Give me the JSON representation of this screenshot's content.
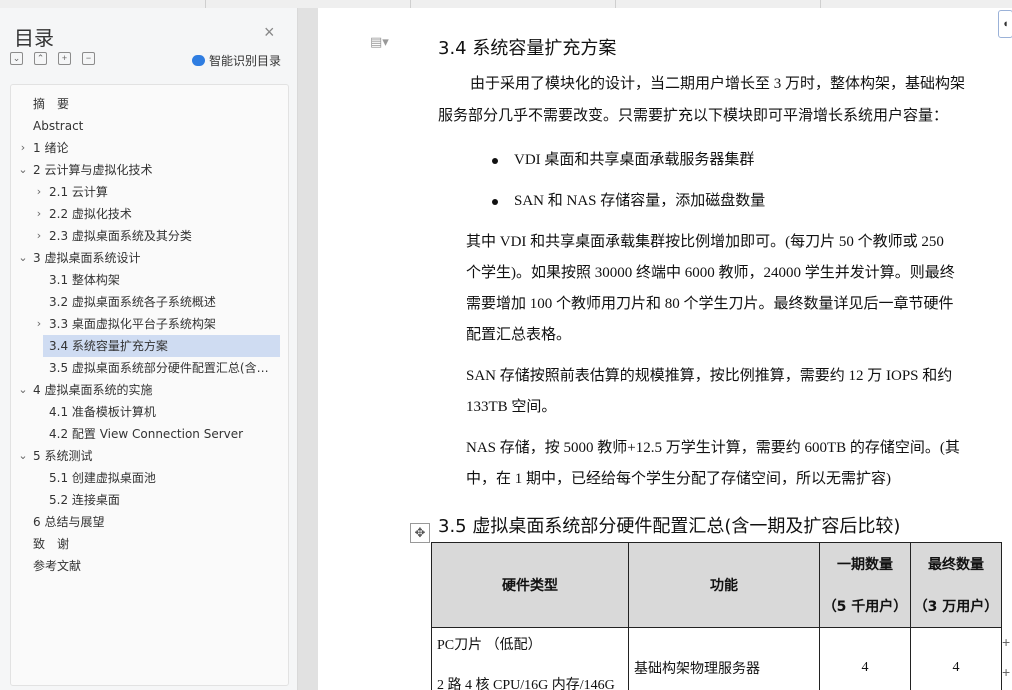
{
  "sidebar": {
    "title": "目录",
    "close_icon": "×",
    "smart_label": "智能识别目录",
    "items": [
      {
        "label": "摘　要",
        "level": 0,
        "expander": "",
        "selected": false
      },
      {
        "label": "Abstract",
        "level": 0,
        "expander": "",
        "selected": false
      },
      {
        "label": "1 绪论",
        "level": 0,
        "expander": "collapsed",
        "selected": false
      },
      {
        "label": "2 云计算与虚拟化技术",
        "level": 0,
        "expander": "expanded",
        "selected": false
      },
      {
        "label": "2.1 云计算",
        "level": 1,
        "expander": "collapsed",
        "selected": false
      },
      {
        "label": "2.2  虚拟化技术",
        "level": 1,
        "expander": "collapsed",
        "selected": false
      },
      {
        "label": "2.3  虚拟桌面系统及其分类",
        "level": 1,
        "expander": "collapsed",
        "selected": false
      },
      {
        "label": "3 虚拟桌面系统设计",
        "level": 0,
        "expander": "expanded",
        "selected": false
      },
      {
        "label": "3.1 整体构架",
        "level": 1,
        "expander": "",
        "selected": false
      },
      {
        "label": "3.2 虚拟桌面系统各子系统概述",
        "level": 1,
        "expander": "",
        "selected": false
      },
      {
        "label": "3.3 桌面虚拟化平台子系统构架",
        "level": 1,
        "expander": "collapsed",
        "selected": false
      },
      {
        "label": "3.4 系统容量扩充方案",
        "level": 1,
        "expander": "",
        "selected": true
      },
      {
        "label": "3.5 虚拟桌面系统部分硬件配置汇总(含…",
        "level": 1,
        "expander": "",
        "selected": false
      },
      {
        "label": "4 虚拟桌面系统的实施",
        "level": 0,
        "expander": "expanded",
        "selected": false
      },
      {
        "label": "4.1 准备模板计算机",
        "level": 1,
        "expander": "",
        "selected": false
      },
      {
        "label": "4.2 配置 View Connection Server",
        "level": 1,
        "expander": "",
        "selected": false
      },
      {
        "label": "5 系统测试",
        "level": 0,
        "expander": "expanded",
        "selected": false
      },
      {
        "label": "5.1 创建虚拟桌面池",
        "level": 1,
        "expander": "",
        "selected": false
      },
      {
        "label": "5.2  连接桌面",
        "level": 1,
        "expander": "",
        "selected": false
      },
      {
        "label": "6 总结与展望",
        "level": 0,
        "expander": "",
        "selected": false
      },
      {
        "label": "致　谢",
        "level": 0,
        "expander": "",
        "selected": false
      },
      {
        "label": "参考文献",
        "level": 0,
        "expander": "",
        "selected": false
      }
    ]
  },
  "document": {
    "heading_34": "3.4 系统容量扩充方案",
    "para1_line1": "由于采用了模块化的设计，当二期用户增长至 3 万时，整体构架，基础构架",
    "para1_line2": "服务部分几乎不需要改变。只需要扩充以下模块即可平滑增长系统用户容量：",
    "bullet1": "VDI 桌面和共享桌面承载服务器集群",
    "bullet2": "SAN 和 NAS 存储容量，添加磁盘数量",
    "para2_line1": "其中 VDI 和共享桌面承载集群按比例增加即可。(每刀片 50 个教师或 250",
    "para2_line2": "个学生)。如果按照 30000 终端中 6000 教师，24000 学生并发计算。则最终",
    "para2_line3": "需要增加 100 个教师用刀片和 80 个学生刀片。最终数量详见后一章节硬件",
    "para2_line4": "配置汇总表格。",
    "para3_line1": "SAN 存储按照前表估算的规模推算，按比例推算，需要约 12 万 IOPS 和约",
    "para3_line2": "133TB 空间。",
    "para4_line1": "NAS 存储，按 5000 教师+12.5 万学生计算，需要约 600TB 的存储空间。(其",
    "para4_line2": "中，在 1 期中，已经给每个学生分配了存储空间，所以无需扩容)",
    "heading_35": "3.5 虚拟桌面系统部分硬件配置汇总(含一期及扩容后比较)",
    "table": {
      "col_hw": "硬件类型",
      "col_func": "功能",
      "col_phase1_a": "一期数量",
      "col_phase1_b": "（5 千用户）",
      "col_final_a": "最终数量",
      "col_final_b": "（3 万用户）",
      "row1_hw_a": "PC刀片 （低配）",
      "row1_hw_b": "2 路 4 核 CPU/16G 内存/146G",
      "row1_func": "基础构架物理服务器",
      "row1_phase1": "4",
      "row1_final": "4"
    }
  }
}
